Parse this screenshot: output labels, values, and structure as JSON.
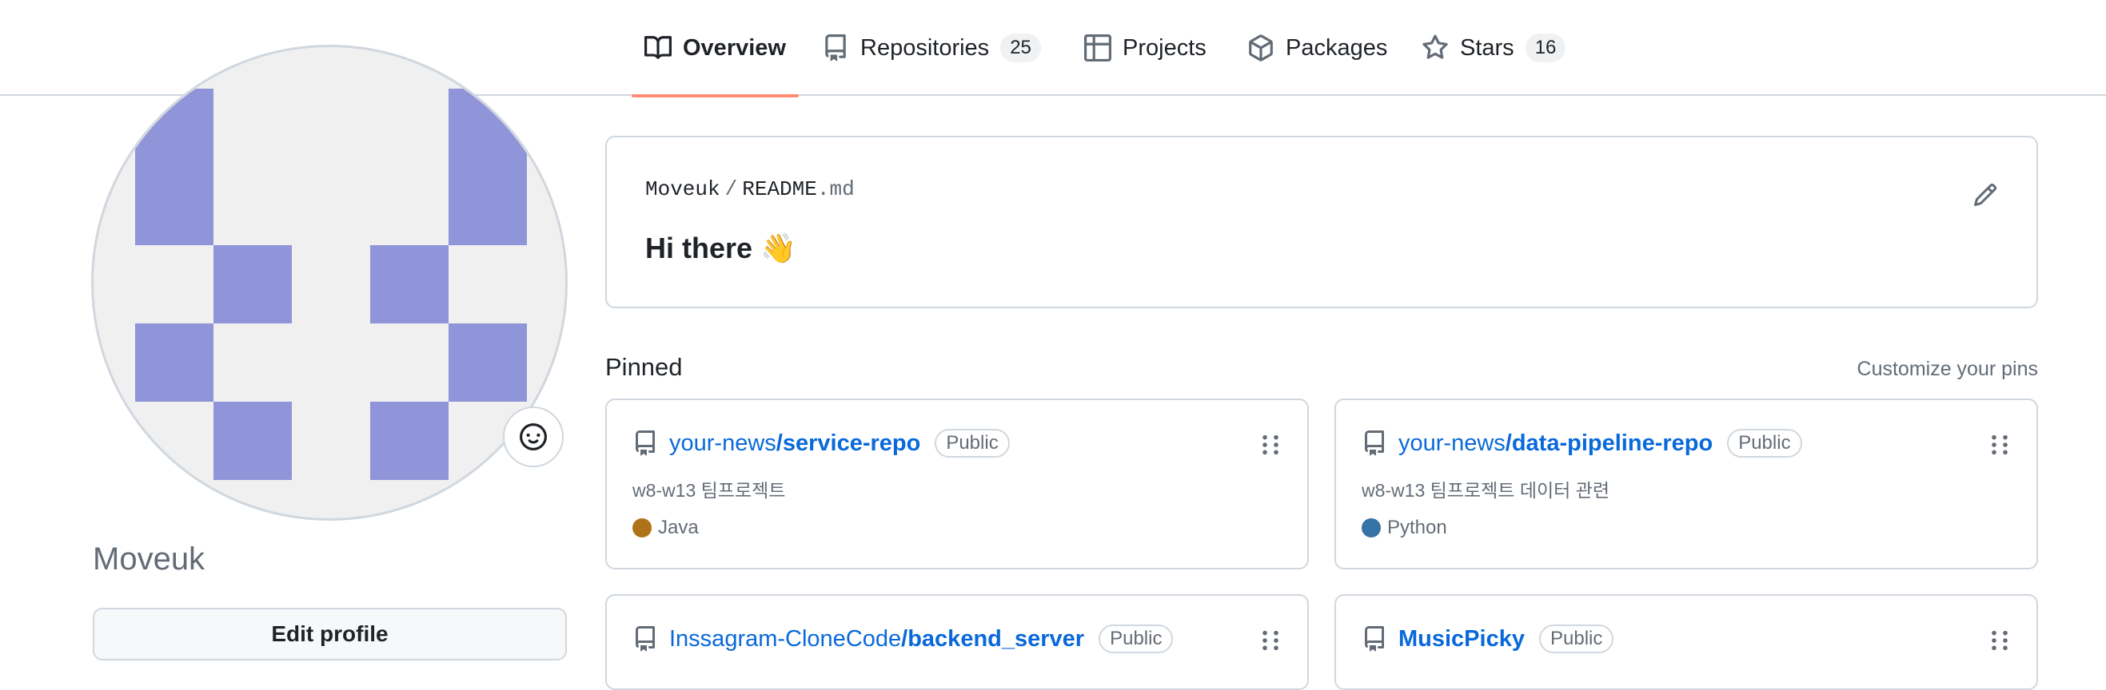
{
  "nav": {
    "tabs": [
      {
        "label": "Overview",
        "icon": "book-icon",
        "selected": true
      },
      {
        "label": "Repositories",
        "icon": "repo-icon",
        "count": "25"
      },
      {
        "label": "Projects",
        "icon": "table-icon"
      },
      {
        "label": "Packages",
        "icon": "package-icon"
      },
      {
        "label": "Stars",
        "icon": "star-icon",
        "count": "16"
      }
    ],
    "selected_underline_color": "#fd8c73"
  },
  "profile": {
    "username": "Moveuk",
    "edit_label": "Edit profile",
    "avatar_color": "#9094d8",
    "status_icon": "smiley-icon"
  },
  "readme": {
    "owner": "Moveuk",
    "file_base": "README",
    "file_ext": ".md",
    "heading": "Hi there",
    "heading_emoji": "👋",
    "edit_icon": "pencil-icon"
  },
  "pinned": {
    "title": "Pinned",
    "customize_label": "Customize your pins",
    "items": [
      {
        "owner": "your-news",
        "name": "/service-repo",
        "visibility": "Public",
        "description": "w8-w13 팀프로젝트",
        "language": "Java",
        "language_color": "#b07219"
      },
      {
        "owner": "your-news",
        "name": "/data-pipeline-repo",
        "visibility": "Public",
        "description": "w8-w13 팀프로젝트 데이터 관련",
        "language": "Python",
        "language_color": "#3572A5"
      },
      {
        "owner": "Inssagram-CloneCode",
        "name": "/backend_server",
        "visibility": "Public",
        "description": "",
        "language": "",
        "language_color": ""
      },
      {
        "owner": "",
        "name": "MusicPicky",
        "visibility": "Public",
        "description": "",
        "language": "",
        "language_color": ""
      }
    ]
  },
  "colors": {
    "link": "#0969da",
    "border": "#d0d7de",
    "muted": "#636c76"
  }
}
